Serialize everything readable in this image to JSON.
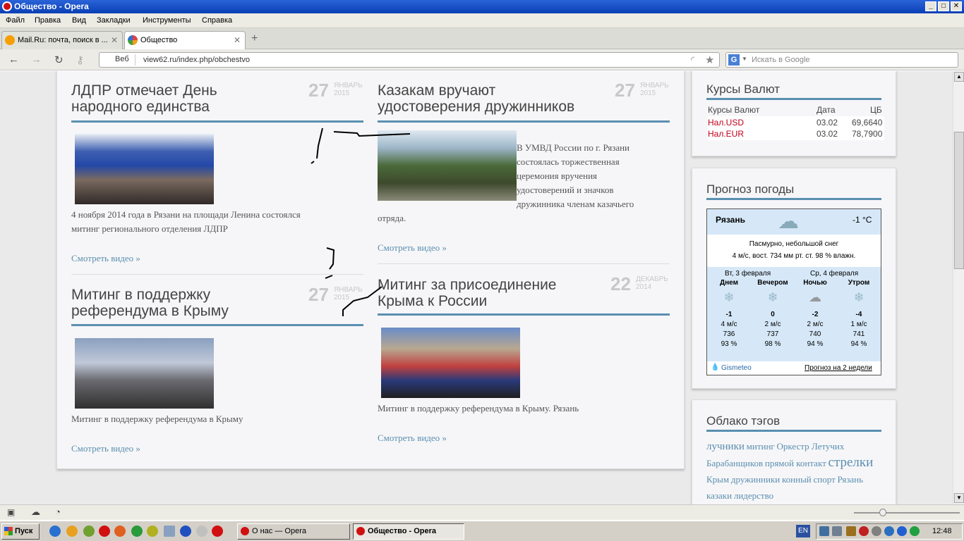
{
  "window": {
    "title": "Общество - Opera",
    "minimize": "_",
    "maximize": "□",
    "close": "✕"
  },
  "menu": [
    "Файл",
    "Правка",
    "Вид",
    "Закладки",
    "Инструменты",
    "Справка"
  ],
  "tabs": [
    {
      "label": "Mail.Ru: почта, поиск в ...",
      "icon": "mailru-icon",
      "active": false
    },
    {
      "label": "Общество",
      "icon": "joomla-icon",
      "active": true
    }
  ],
  "address": {
    "badge": "Веб",
    "url": "view62.ru/index.php/obchestvo",
    "search_placeholder": "Искать в Google"
  },
  "articles": [
    {
      "title_l1": "ЛДПР отмечает День",
      "title_l2": "народного единства",
      "day": "27",
      "month": "ЯНВАРЬ",
      "year": "2015",
      "text_l1": "4 ноября 2014 года в Рязани на площади Ленина состоялся",
      "text_l2": "митинг регионального отделения ЛДПР",
      "link": "Смотреть видео »"
    },
    {
      "title_l1": "Казакам вручают",
      "title_l2": "удостоверения дружинников",
      "day": "27",
      "month": "ЯНВАРЬ",
      "year": "2015",
      "text_lines": [
        "В УМВД России по г. Рязани",
        "состоялась торжественная",
        "церемония вручения",
        "удостоверений и значков",
        "дружинника членам казачьего"
      ],
      "text_tail": "отряда.",
      "link": "Смотреть видео »"
    },
    {
      "title_l1": "Митинг в поддержку",
      "title_l2": "референдума в Крыму",
      "day": "27",
      "month": "ЯНВАРЬ",
      "year": "2015",
      "text_l1": "Митинг в поддержку референдума в Крыму",
      "link": "Смотреть видео »"
    },
    {
      "title_l1": "Митинг за присоединение",
      "title_l2": "Крыма к России",
      "day": "22",
      "month": "ДЕКАБРЬ",
      "year": "2014",
      "text_l1": "Митинг в поддержку референдума в Крыму. Рязань",
      "link": "Смотреть видео »"
    }
  ],
  "currency": {
    "title": "Курсы Валют",
    "headers": [
      "Курсы Валют",
      "Дата",
      "ЦБ"
    ],
    "rows": [
      {
        "name": "Нал.USD",
        "date": "03.02",
        "value": "69,6640"
      },
      {
        "name": "Нал.EUR",
        "date": "03.02",
        "value": "78,7900"
      }
    ]
  },
  "weather": {
    "title": "Прогноз погоды",
    "city": "Рязань",
    "temp": "-1 °C",
    "desc": "Пасмурно, небольшой снег",
    "details": "4 м/с, вост.   734 мм рт. ст.   98 % влажн.",
    "day1": "Вт, 3 февраля",
    "day2": "Ср, 4 февраля",
    "periods": [
      {
        "label": "Днем",
        "temp": "-1",
        "wind": "4 м/с",
        "pressure": "736",
        "humidity": "93 %"
      },
      {
        "label": "Вечером",
        "temp": "0",
        "wind": "2 м/с",
        "pressure": "737",
        "humidity": "98 %"
      },
      {
        "label": "Ночью",
        "temp": "-2",
        "wind": "2 м/с",
        "pressure": "740",
        "humidity": "94 %"
      },
      {
        "label": "Утром",
        "temp": "-4",
        "wind": "1 м/с",
        "pressure": "741",
        "humidity": "94 %"
      }
    ],
    "brand": "Gismeteo",
    "forecast_link": "Прогноз на 2 недели"
  },
  "tags": {
    "title": "Облако тэгов",
    "items": [
      "лучники",
      "митинг",
      "Оркестр Летучих",
      "Барабанщиков",
      "прямой контакт",
      "стрелки",
      "Крым",
      "дружинники",
      "конный",
      "спорт",
      "Рязань",
      "казаки",
      "лидерство"
    ]
  },
  "taskbar": {
    "start": "Пуск",
    "buttons": [
      "О нас — Opera",
      "Общество - Opera"
    ],
    "lang": "EN",
    "clock": "12:48"
  },
  "colors": {
    "accent": "#5b8fb0",
    "link": "#5b8fb0",
    "currency_red": "#c0001a",
    "titlebar": "#0a3fb5"
  }
}
